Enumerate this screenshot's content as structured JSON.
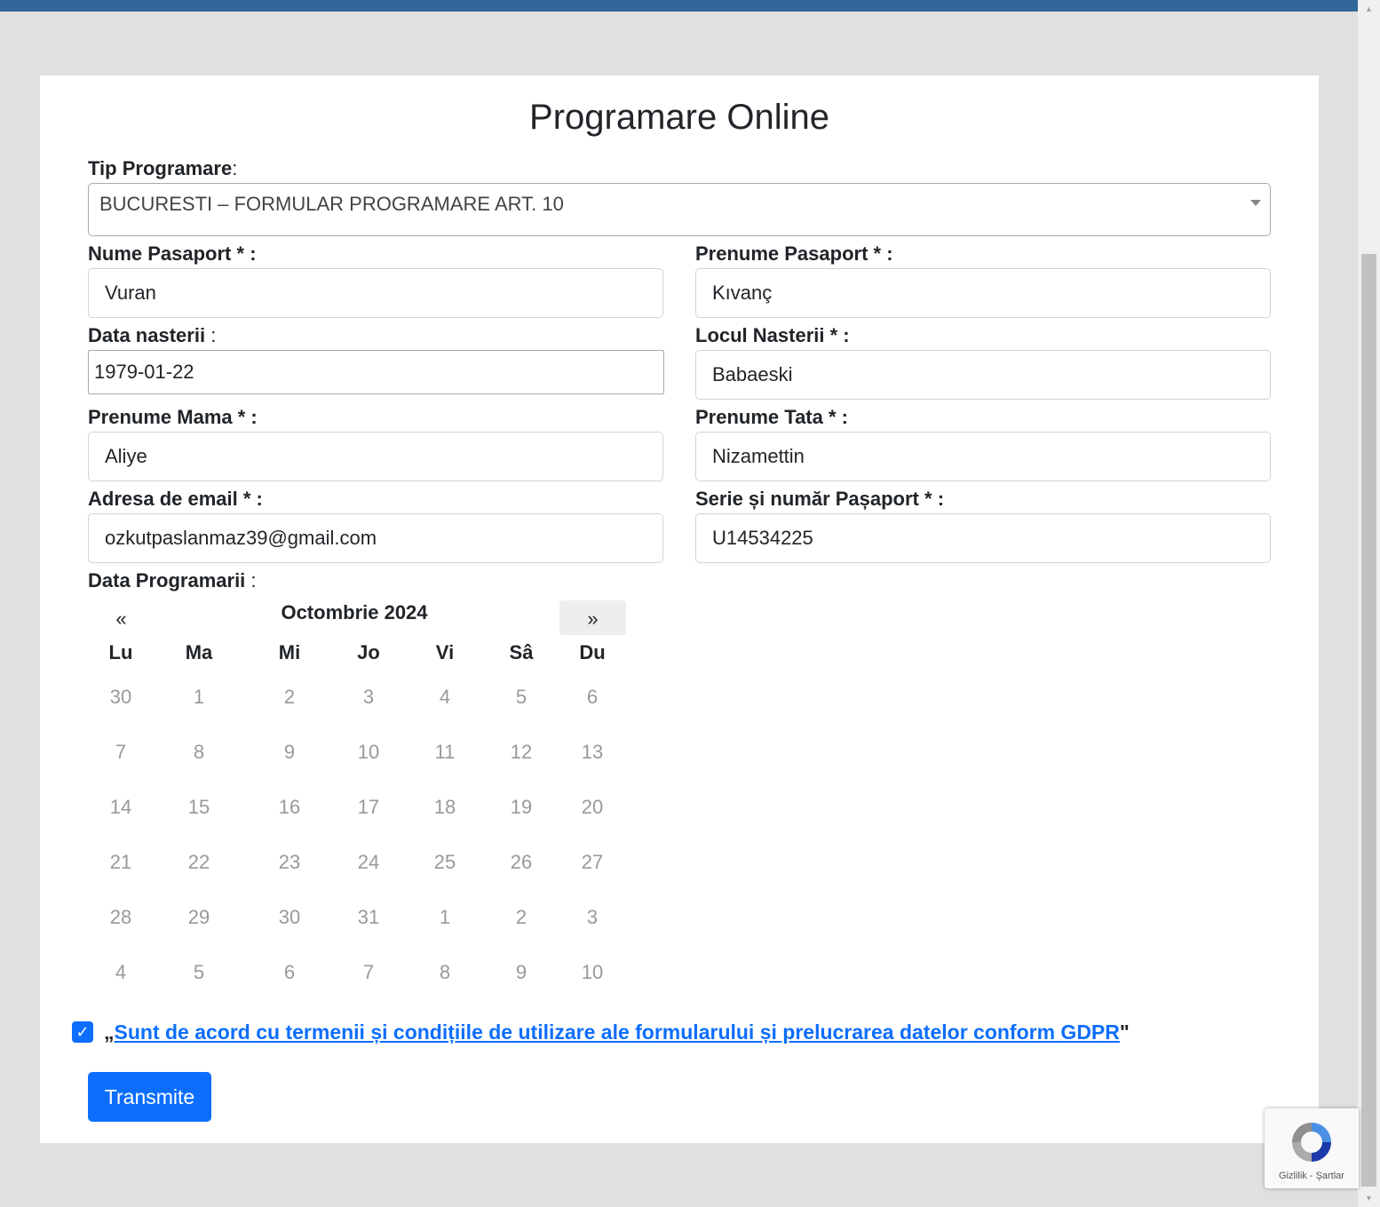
{
  "page": {
    "title": "Programare Online"
  },
  "form": {
    "tip_label": "Tip Programare",
    "tip_value": "BUCURESTI – FORMULAR PROGRAMARE ART. 10",
    "colon": ":",
    "req_suffix": "* :",
    "fields": {
      "nume": {
        "label": "Nume Pasaport",
        "value": "Vuran"
      },
      "prenume": {
        "label": "Prenume Pasaport",
        "value": "Kıvanç"
      },
      "data_nasterii": {
        "label": "Data nasterii",
        "value": "1979-01-22"
      },
      "locul_nasterii": {
        "label": "Locul Nasterii",
        "value": "Babaeski"
      },
      "prenume_mama": {
        "label": "Prenume Mama",
        "value": "Aliye"
      },
      "prenume_tata": {
        "label": "Prenume Tata",
        "value": "Nizamettin"
      },
      "email": {
        "label": "Adresa de email",
        "value": "ozkutpaslanmaz39@gmail.com"
      },
      "pasaport": {
        "label": "Serie și număr Pașaport",
        "value": "U14534225"
      }
    },
    "data_programarii_label": "Data Programarii"
  },
  "calendar": {
    "month_label": "Octombrie 2024",
    "prev": "«",
    "next": "»",
    "weekdays": [
      "Lu",
      "Ma",
      "Mi",
      "Jo",
      "Vi",
      "Sâ",
      "Du"
    ],
    "weeks": [
      [
        "30",
        "1",
        "2",
        "3",
        "4",
        "5",
        "6"
      ],
      [
        "7",
        "8",
        "9",
        "10",
        "11",
        "12",
        "13"
      ],
      [
        "14",
        "15",
        "16",
        "17",
        "18",
        "19",
        "20"
      ],
      [
        "21",
        "22",
        "23",
        "24",
        "25",
        "26",
        "27"
      ],
      [
        "28",
        "29",
        "30",
        "31",
        "1",
        "2",
        "3"
      ],
      [
        "4",
        "5",
        "6",
        "7",
        "8",
        "9",
        "10"
      ]
    ]
  },
  "consent": {
    "open_quote": "„",
    "link_text": "Sunt de acord cu termenii și condițiile de utilizare ale formularului și prelucrarea datelor conform GDPR",
    "close_quote": "\"",
    "checked": true
  },
  "submit_label": "Transmite",
  "recaptcha": {
    "text": "Gizlilik - Şartlar"
  },
  "colors": {
    "accent": "#0d6efd",
    "topbar": "#336699"
  },
  "icons": {
    "checkbox": "check-icon",
    "recaptcha": "recaptcha-logo-icon"
  }
}
